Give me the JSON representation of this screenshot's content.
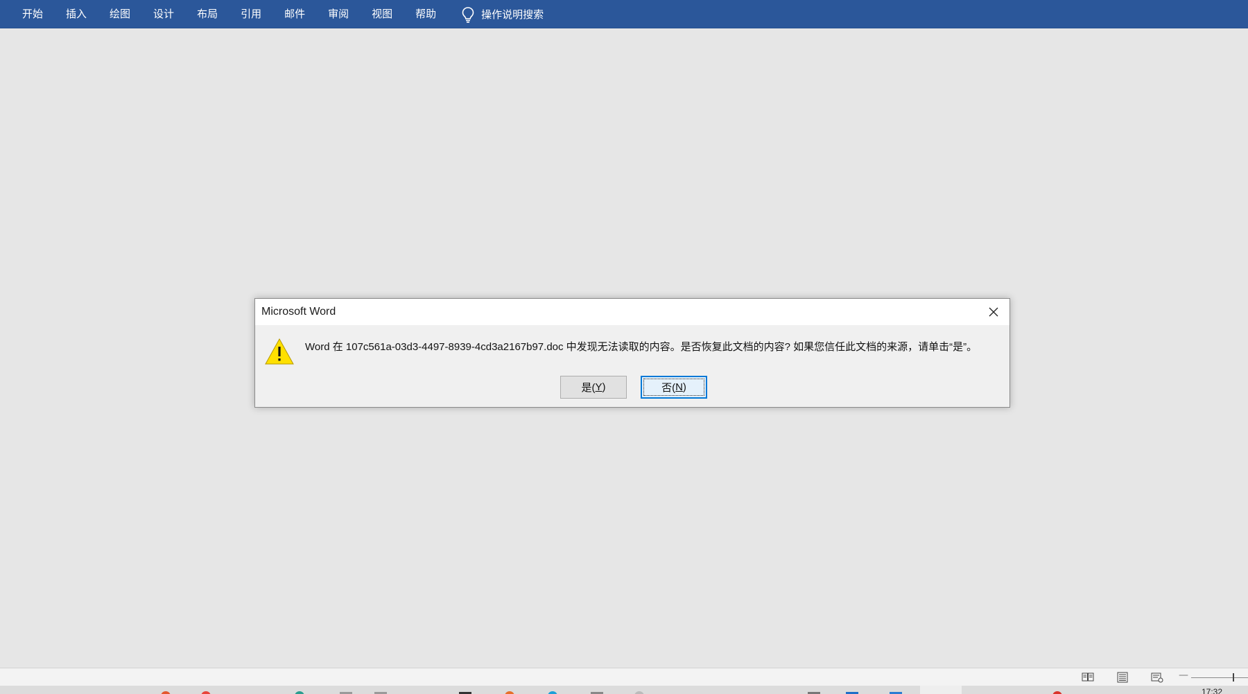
{
  "ribbon": {
    "tabs": [
      {
        "label": "开始"
      },
      {
        "label": "插入"
      },
      {
        "label": "绘图"
      },
      {
        "label": "设计"
      },
      {
        "label": "布局"
      },
      {
        "label": "引用"
      },
      {
        "label": "邮件"
      },
      {
        "label": "审阅"
      },
      {
        "label": "视图"
      },
      {
        "label": "帮助"
      }
    ],
    "tell_me": {
      "icon": "lightbulb-icon",
      "label": "操作说明搜索"
    },
    "color": "#2b579a"
  },
  "dialog": {
    "title": "Microsoft Word",
    "close_icon": "close-icon",
    "warning_icon": "warning-icon",
    "message": "Word 在 107c561a-03d3-4497-8939-4cd3a2167b97.doc 中发现无法读取的内容。是否恢复此文档的内容? 如果您信任此文档的来源，请单击“是”。",
    "buttons": {
      "yes": {
        "label": "是(",
        "key": "Y",
        "suffix": ")"
      },
      "no": {
        "label": "否(",
        "key": "N",
        "suffix": ")"
      }
    }
  },
  "statusbar": {
    "view_icons": [
      "read-mode-icon",
      "print-layout-icon",
      "web-layout-icon"
    ],
    "zoom_minus": "—"
  },
  "taskbar": {
    "clock": "17:32"
  }
}
